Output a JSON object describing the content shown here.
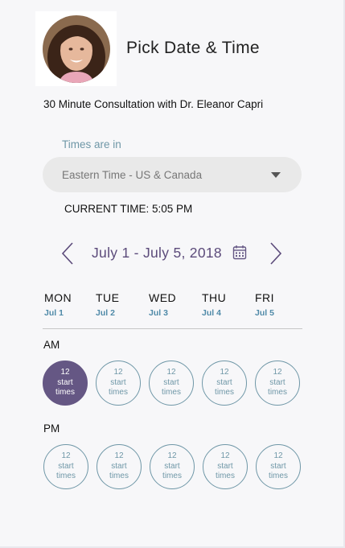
{
  "header": {
    "title": "Pick Date & Time",
    "subtitle": "30 Minute Consultation with Dr. Eleanor Capri"
  },
  "timezone": {
    "label": "Times are in",
    "selected": "Eastern Time - US & Canada",
    "current_time": "CURRENT TIME: 5:05 PM"
  },
  "date_nav": {
    "range": "July 1 - July 5, 2018"
  },
  "days": [
    {
      "name": "MON",
      "date": "Jul 1"
    },
    {
      "name": "TUE",
      "date": "Jul 2"
    },
    {
      "name": "WED",
      "date": "Jul 3"
    },
    {
      "name": "THU",
      "date": "Jul 4"
    },
    {
      "name": "FRI",
      "date": "Jul 5"
    }
  ],
  "am": {
    "label": "AM",
    "slots": [
      {
        "count": "12",
        "line1": "start",
        "line2": "times",
        "selected": true
      },
      {
        "count": "12",
        "line1": "start",
        "line2": "times"
      },
      {
        "count": "12",
        "line1": "start",
        "line2": "times"
      },
      {
        "count": "12",
        "line1": "start",
        "line2": "times"
      },
      {
        "count": "12",
        "line1": "start",
        "line2": "times"
      }
    ]
  },
  "pm": {
    "label": "PM",
    "slots": [
      {
        "count": "12",
        "line1": "start",
        "line2": "times"
      },
      {
        "count": "12",
        "line1": "start",
        "line2": "times"
      },
      {
        "count": "12",
        "line1": "start",
        "line2": "times"
      },
      {
        "count": "12",
        "line1": "start",
        "line2": "times"
      },
      {
        "count": "12",
        "line1": "start",
        "line2": "times"
      }
    ]
  },
  "colors": {
    "accent": "#655784",
    "teal": "#6f97a7",
    "date_blue": "#4f8aa8"
  }
}
